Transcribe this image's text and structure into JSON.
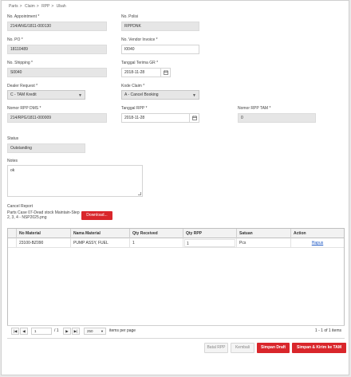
{
  "breadcrumb": [
    "Parts",
    ">",
    "Claim",
    ">",
    "RPP",
    ">",
    "Ubah"
  ],
  "fields": {
    "no_appointment": {
      "label": "No. Appointment *",
      "value": "214/ANG/1811-000130"
    },
    "no_polisi": {
      "label": "No. Polisi",
      "value": "RPPDNK"
    },
    "no_po": {
      "label": "No. PO *",
      "value": "18110489"
    },
    "no_vendor_invoice": {
      "label": "No. Vendor Invoice *",
      "value": "I0040"
    },
    "no_shipping": {
      "label": "No. Shipping *",
      "value": "S0040"
    },
    "tanggal_terima_gr": {
      "label": "Tanggal Terima GR *",
      "value": "2018-11-28"
    },
    "dealer_request": {
      "label": "Dealer Request *",
      "value": "C - TAM Kredit"
    },
    "kode_claim": {
      "label": "Kode Claim *",
      "value": "A - Cancel Booking"
    },
    "nomor_rpp_dms": {
      "label": "Nomor RPP DMS *",
      "value": "214/RPG/1811-000009"
    },
    "tanggal_rpp": {
      "label": "Tanggal RPP *",
      "value": "2018-11-28"
    },
    "nomor_rpp_tam": {
      "label": "Nomor RPP TAM *",
      "value": "0"
    },
    "status": {
      "label": "Status",
      "value": "Outstanding"
    },
    "notes": {
      "label": "Notes",
      "value": "ok"
    }
  },
  "cancel_report": {
    "label": "Cancel Report",
    "filename": "Parts Case 07-Dead stock Maintain-Step 2, 3, 4 - NSP2025.png",
    "download_label": "Download..."
  },
  "grid": {
    "columns": [
      "No Material",
      "Nama Material",
      "Qty Received",
      "Qty RPP",
      "Satuan",
      "Action"
    ],
    "rows": [
      {
        "no_material": "23100-BZ090",
        "nama_material": "PUMP ASSY, FUEL",
        "qty_received": "1",
        "qty_rpp": "1",
        "satuan": "Pcs",
        "action": "Hapus"
      }
    ]
  },
  "pager": {
    "first": "|◀",
    "prev": "◀",
    "page": "1",
    "of_pages": "/ 1",
    "next": "▶",
    "last": "▶|",
    "page_size": "250",
    "items_per_page": "items per page",
    "summary": "1 - 1 of 1 items"
  },
  "actions": {
    "batal_rpp": "Batal RPP",
    "kembali": "Kembali",
    "simpan_draft": "Simpan Draft",
    "simpan_kirim": "Simpan & Kirim ke TAM"
  },
  "icons": {
    "calendar": "calendar-icon",
    "dropdown": "chevron-down-icon"
  },
  "colors": {
    "accent": "#d9262b",
    "readonly_bg": "#e6e6e6"
  }
}
